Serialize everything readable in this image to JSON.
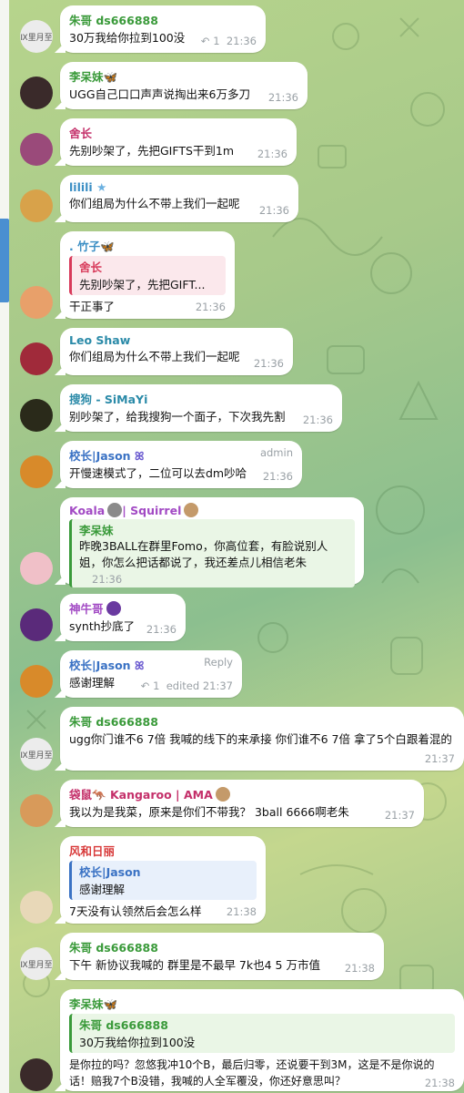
{
  "messages": [
    {
      "name": "朱哥 ds666888",
      "text": "30万我给你拉到100没",
      "reply_count": "1",
      "time": "21:36"
    },
    {
      "name": "李呆妹",
      "text": "UGG自己口口声声说掏出来6万多刀",
      "time": "21:36"
    },
    {
      "name": "舍长",
      "text": "先别吵架了，先把GIFTS干到1m",
      "time": "21:36"
    },
    {
      "name": "lilili",
      "text": "你们组局为什么不带上我们一起呢",
      "time": "21:36"
    },
    {
      "name": ". 竹子",
      "reply_name": "舍长",
      "reply_text": "先别吵架了，先把GIFT...",
      "text": "干正事了",
      "time": "21:36"
    },
    {
      "name": "Leo Shaw",
      "text": "你们组局为什么不带上我们一起呢",
      "time": "21:36"
    },
    {
      "name": "搜狗 - SiMaYi",
      "text": "别吵架了，给我搜狗一个面子，下次我先割",
      "time": "21:36"
    },
    {
      "name": "校长|Jason",
      "role": "admin",
      "text": "开慢速模式了，二位可以去dm吵哈",
      "time": "21:36"
    },
    {
      "name": "Koala",
      "name2": "| Squirrel",
      "reply_name": "李呆妹",
      "reply_text": "昨晚3BALL在群里Fomo，你高位套，有脸说别人姐，你怎么把话都说了，我还差点儿相信老朱",
      "time": "21:36"
    },
    {
      "name": "神牛哥",
      "text": "synth抄底了",
      "time": "21:36"
    },
    {
      "name": "校长|Jason",
      "role": "Reply",
      "text": "感谢理解",
      "reply_count": "1",
      "edited": "edited",
      "time": "21:37"
    },
    {
      "name": "朱哥 ds666888",
      "text": "ugg你门谁不6 7倍 我喊的线下的来承接 你们谁不6 7倍 拿了5个白跟着混的",
      "time": "21:37"
    },
    {
      "name": "袋鼠",
      "name2": "Kangaroo | AMA",
      "text": "我以为是我菜，原来是你们不带我？ 3ball 6666啊老朱",
      "time": "21:37"
    },
    {
      "name": "风和日丽",
      "reply_name": "校长|Jason",
      "reply_text": "感谢理解",
      "text": "7天没有认领然后会怎么样",
      "time": "21:38"
    },
    {
      "name": "朱哥 ds666888",
      "text": "下午 新协议我喊的 群里是不最早 7k也4 5 万市值",
      "time": "21:38"
    },
    {
      "name": "李呆妹",
      "reply_name": "朱哥 ds666888",
      "reply_text": "30万我给你拉到100没",
      "text": "是你拉的吗？忽悠我冲10个B，最后归零，还说要干到3M，这是不是你说的话！赔我7个B没错，我喊的人全军覆没，你还好意思叫？",
      "time": "21:38"
    }
  ],
  "avatar_labels": {
    "a1": "Ⅸ⾥⽉⾄",
    "a13": "Ⅸ⾥⽉⾄",
    "a15": "Ⅸ⾥⽉⾄"
  }
}
